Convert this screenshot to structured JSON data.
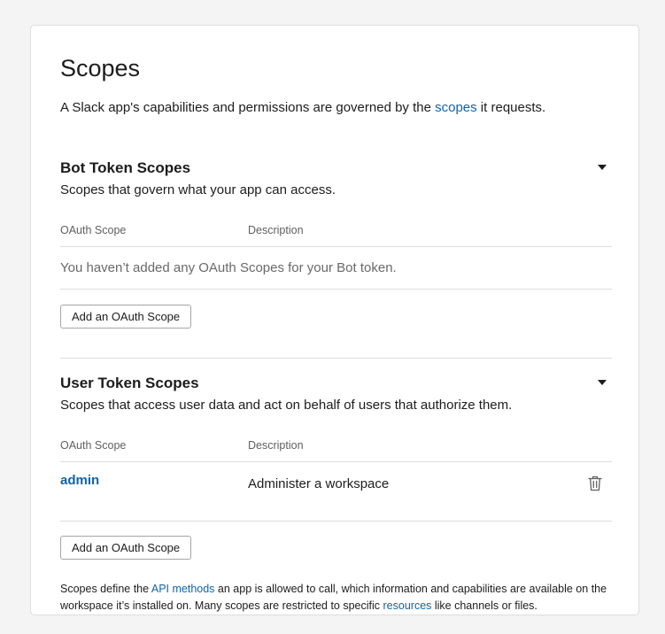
{
  "page": {
    "title": "Scopes",
    "intro_before": "A Slack app's capabilities and permissions are governed by the ",
    "intro_link": "scopes",
    "intro_after": " it requests."
  },
  "bot": {
    "heading": "Bot Token Scopes",
    "subtitle": "Scopes that govern what your app can access.",
    "col_scope": "OAuth Scope",
    "col_description": "Description",
    "empty_message": "You haven’t added any OAuth Scopes for your Bot token.",
    "add_button": "Add an OAuth Scope",
    "caret_icon": "caret-down-icon"
  },
  "user": {
    "heading": "User Token Scopes",
    "subtitle": "Scopes that access user data and act on behalf of users that authorize them.",
    "col_scope": "OAuth Scope",
    "col_description": "Description",
    "rows": [
      {
        "scope": "admin",
        "description": "Administer a workspace",
        "action_icon": "trash-icon"
      }
    ],
    "add_button": "Add an OAuth Scope",
    "caret_icon": "caret-down-icon"
  },
  "footer": {
    "part1": "Scopes define the ",
    "link1": "API methods",
    "part2": " an app is allowed to call, which information and capabilities are available on the workspace it’s installed on. Many scopes are restricted to specific ",
    "link2": "resources",
    "part3": " like channels or files."
  },
  "colors": {
    "link": "#1264a3",
    "text": "#1d1c1d",
    "muted": "#616061",
    "border": "#dddddd",
    "background": "#f4f4f4"
  }
}
